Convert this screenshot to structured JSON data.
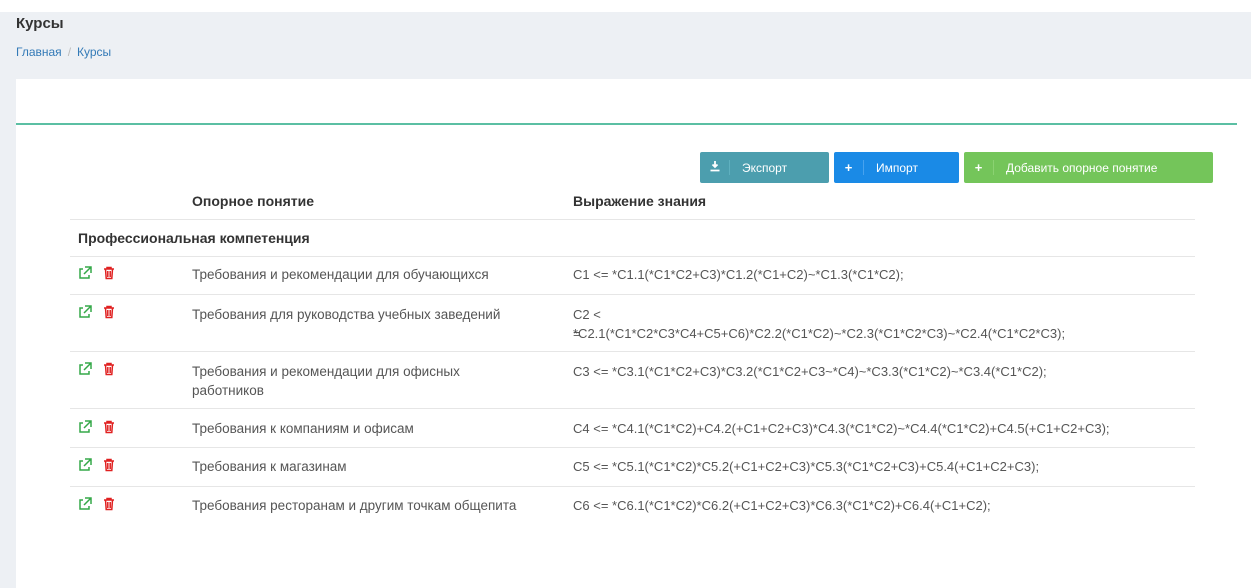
{
  "header": {
    "title": "Курсы",
    "breadcrumb": [
      "Главная",
      "Курсы"
    ]
  },
  "toolbar": {
    "export_label": "Экспорт",
    "import_label": "Импорт",
    "add_label": "Добавить опорное понятие"
  },
  "table": {
    "columns": [
      "Опорное понятие",
      "Выражение знания"
    ],
    "group": "Профессиональная компетенция",
    "rows": [
      {
        "name": "Требования и рекомендации для обучающихся",
        "expr": "C1 <= *C1.1(*C1*C2+C3)*C1.2(*C1+C2)~*C1.3(*C1*C2);"
      },
      {
        "name": "Требования для руководства учебных заведений",
        "expr": "C2 <= *C2.1(*C1*C2*C3*C4+C5+C6)*C2.2(*C1*C2)~*C2.3(*C1*C2*C3)~*C2.4(*C1*C2*C3);"
      },
      {
        "name": "Требования и рекомендации для офисных работников",
        "expr": "C3 <= *C3.1(*C1*C2+C3)*C3.2(*C1*C2+C3~*C4)~*C3.3(*C1*C2)~*C3.4(*C1*C2);"
      },
      {
        "name": "Требования к компаниям и офисам",
        "expr": "C4 <= *C4.1(*C1*C2)+C4.2(+C1+C2+C3)*C4.3(*C1*C2)~*C4.4(*C1*C2)+C4.5(+C1+C2+C3);"
      },
      {
        "name": "Требования к магазинам",
        "expr": "C5 <= *C5.1(*C1*C2)*C5.2(+C1+C2+C3)*C5.3(*C1*C2+C3)+C5.4(+C1+C2+C3);"
      },
      {
        "name": "Требования ресторанам и другим точкам общепита",
        "expr": "C6 <= *C6.1(*C1*C2)*C6.2(+C1+C2+C3)*C6.3(*C1*C2)+C6.4(+C1+C2);"
      }
    ]
  },
  "colors": {
    "edit_icon": "#35a848",
    "delete_icon": "#e02020",
    "accent_line": "#5bbfa3"
  },
  "icons": {
    "edit": "external-link-icon",
    "delete": "trash-icon",
    "export": "download-icon",
    "import": "plus-icon",
    "add": "plus-icon"
  }
}
